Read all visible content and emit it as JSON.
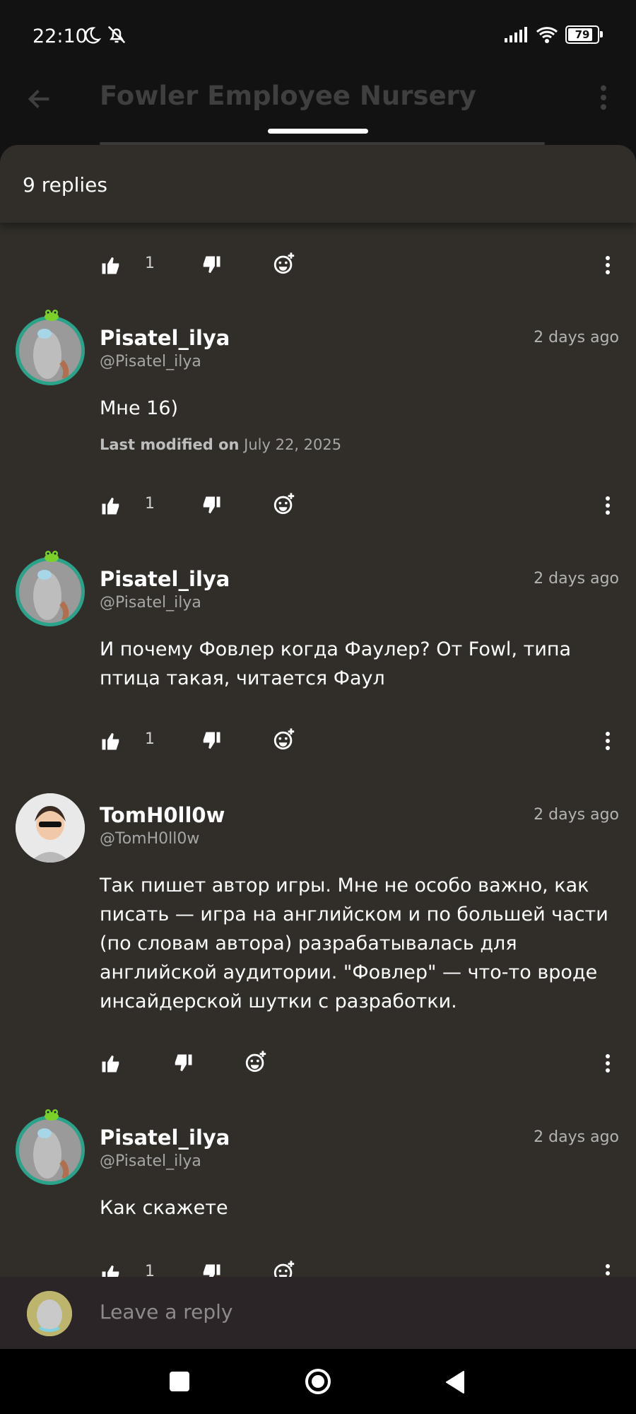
{
  "status": {
    "time": "22:10",
    "battery": "79"
  },
  "appbar": {
    "title": "Fowler Employee Nursery"
  },
  "sheet": {
    "replies_count": "9 replies"
  },
  "top_actions": {
    "like_count": "1"
  },
  "comments": [
    {
      "name": "Pisatel_ilya",
      "handle": "@Pisatel_ilya",
      "time": "2 days ago",
      "body": "Мне 16)",
      "modified_label": "Last modified on",
      "modified_date": "July 22, 2025",
      "like_count": "1"
    },
    {
      "name": "Pisatel_ilya",
      "handle": "@Pisatel_ilya",
      "time": "2 days ago",
      "body": "И почему Фовлер когда Фаулер? От Fowl, типа птица такая, читается Фаул",
      "like_count": "1"
    },
    {
      "name": "TomH0ll0w",
      "handle": "@TomH0ll0w",
      "time": "2 days ago",
      "body": "Так пишет автор игры. Мне не особо важно, как писать — игра на английском и по большей части (по словам автора) разрабатывалась для английской аудитории. \"Фовлер\" — что-то вроде инсайдерской шутки с разработки."
    },
    {
      "name": "Pisatel_ilya",
      "handle": "@Pisatel_ilya",
      "time": "2 days ago",
      "body": "Как скажете",
      "like_count": "1"
    }
  ],
  "reply_bar": {
    "placeholder": "Leave a reply"
  },
  "icons": {
    "back": "arrow-left-icon",
    "more": "more-vertical-icon",
    "like": "thumbs-up-icon",
    "dislike": "thumbs-down-icon",
    "react": "add-reaction-icon"
  },
  "colors": {
    "sheet_bg": "#312e29",
    "accent_ring": "#2aa38a"
  }
}
